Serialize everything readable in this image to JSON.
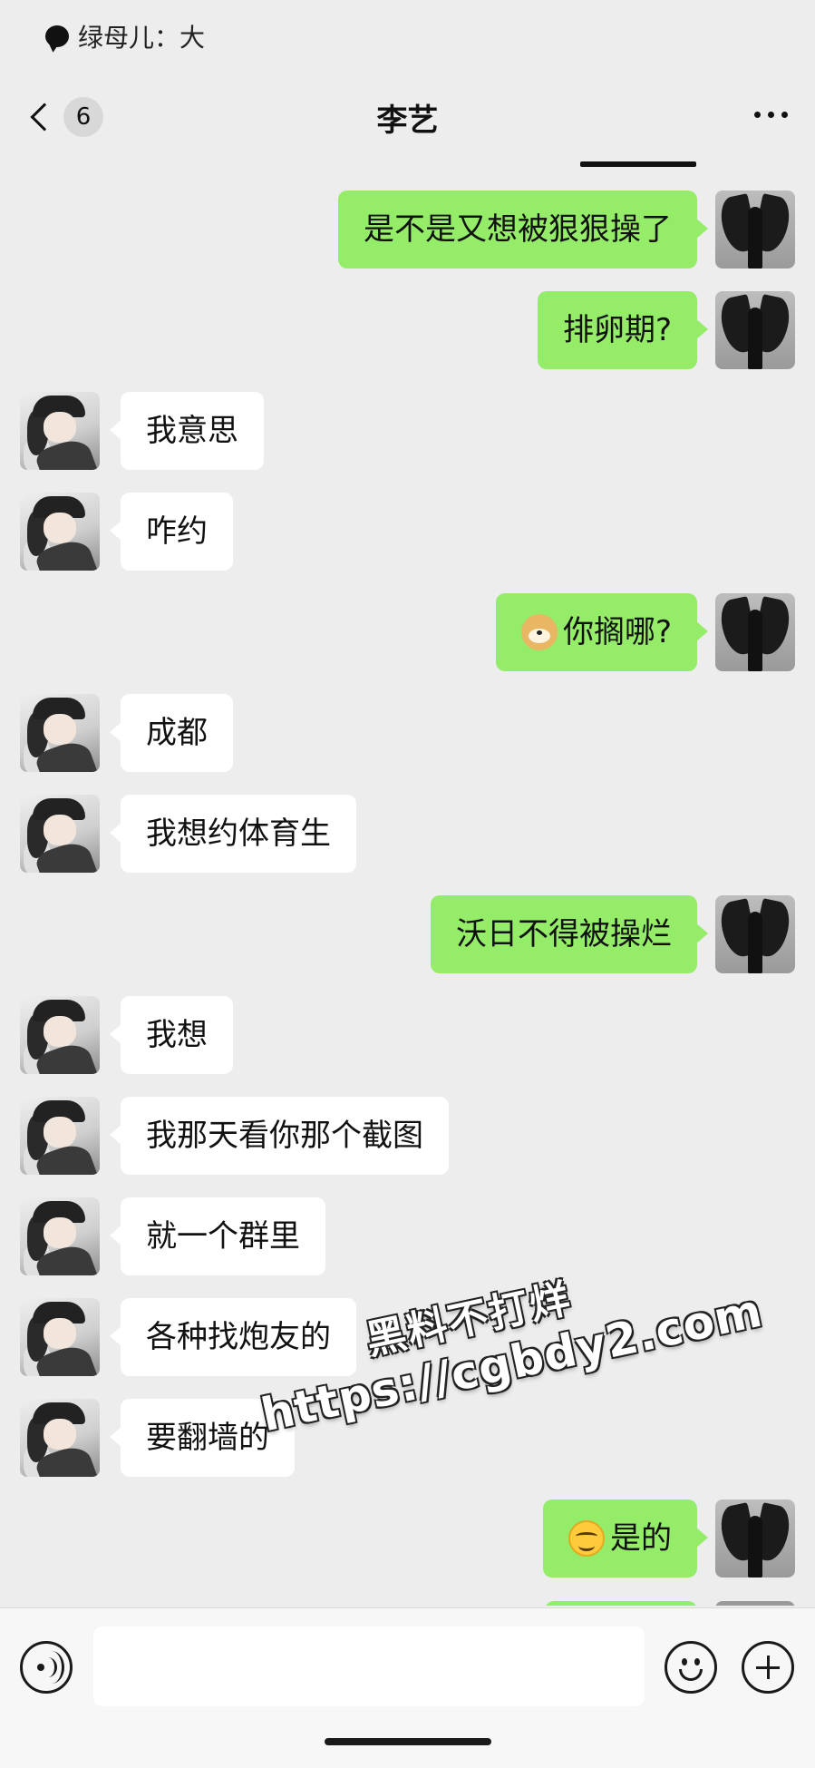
{
  "status": {
    "label": "绿母儿：大"
  },
  "header": {
    "unread_count": "6",
    "title": "李艺"
  },
  "messages": [
    {
      "from": "me",
      "text": "是不是又想被狠狠操了"
    },
    {
      "from": "me",
      "text": "排卵期?"
    },
    {
      "from": "them",
      "text": "我意思"
    },
    {
      "from": "them",
      "text": "咋约"
    },
    {
      "from": "me",
      "emoji": "doge-emoji",
      "text": "你搁哪?"
    },
    {
      "from": "them",
      "text": "成都"
    },
    {
      "from": "them",
      "text": "我想约体育生"
    },
    {
      "from": "me",
      "text": "沃日不得被操烂"
    },
    {
      "from": "them",
      "text": "我想"
    },
    {
      "from": "them",
      "text": "我那天看你那个截图"
    },
    {
      "from": "them",
      "text": "就一个群里"
    },
    {
      "from": "them",
      "text": "各种找炮友的"
    },
    {
      "from": "them",
      "text": "要翻墙的"
    },
    {
      "from": "me",
      "emoji": "grin-emoji",
      "text": "是的"
    }
  ],
  "watermark": {
    "line1": "黑料不打烊",
    "line2": "https://cgbdy2.com"
  },
  "input": {
    "value": "",
    "placeholder": ""
  },
  "colors": {
    "my_bubble": "#95ec69",
    "their_bubble": "#ffffff",
    "background": "#ededed"
  }
}
